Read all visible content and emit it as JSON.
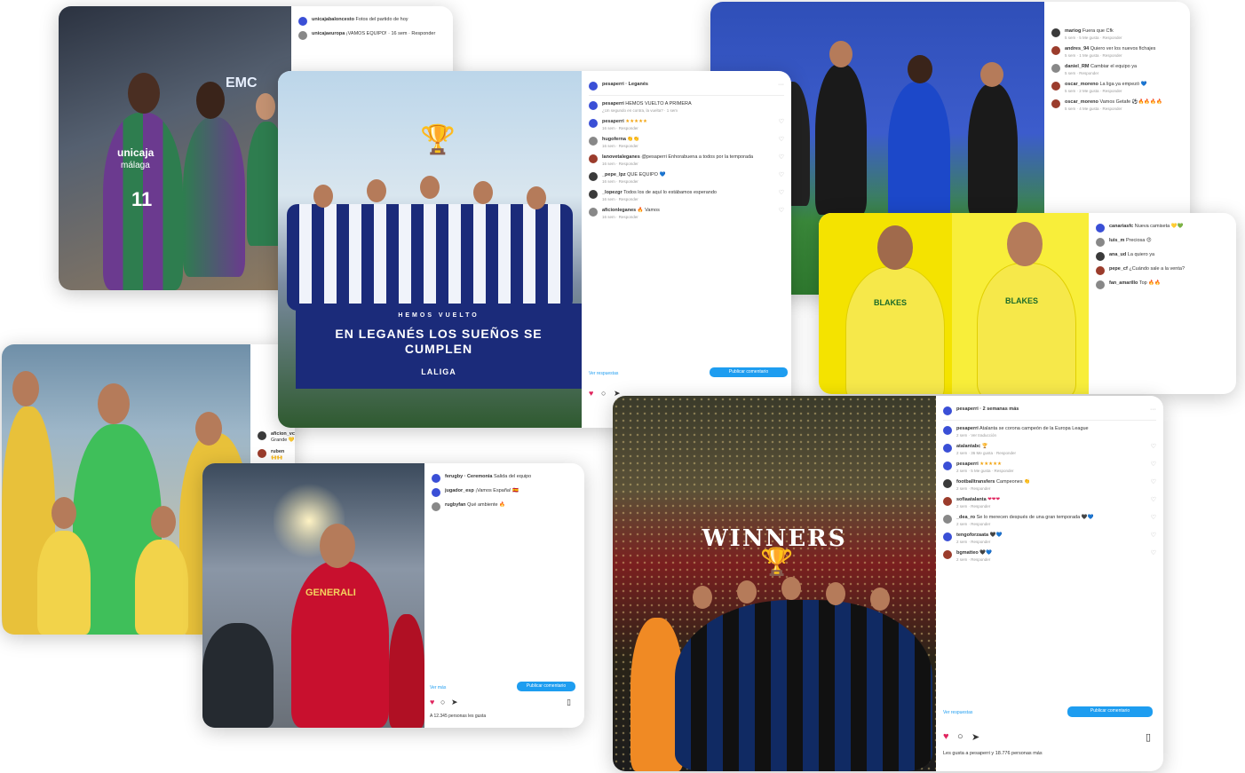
{
  "cards": {
    "basket": {
      "jersey_word": "unicaja",
      "jersey_sub": "málaga",
      "jersey_number": "11",
      "arena_sign": "EMC",
      "comments": [
        {
          "user": "unicajabaloncesto",
          "text": "Fotos del partido de hoy"
        },
        {
          "user": "unicajaeuropa",
          "text": "¡VAMOS EQUIPO! · 16 sem · Responder"
        }
      ]
    },
    "leganes": {
      "header_user": "pesaperri · Leganés",
      "banner_kicker": "HEMOS VUELTO",
      "banner_text": "EN LEGANÉS LOS SUEÑOS SE CUMPLEN",
      "banner_league": "LALIGA",
      "comments": [
        {
          "user": "pesaperri",
          "text": "HEMOS VUELTO A PRIMERA",
          "meta": "¿Un segundo en contra, la vuelta? · 1 sem"
        },
        {
          "user": "pesaperri",
          "text": "★★★★★",
          "meta": "16 sem · Responder"
        },
        {
          "user": "hugoferna",
          "text": "👏👏",
          "meta": "16 sem · Responder"
        },
        {
          "user": "lanovetaleganes",
          "text": "@pesaperri Enhorabuena a todos por la temporada",
          "meta": "16 sem · Responder"
        },
        {
          "user": "_pepe_lpz",
          "text": "QUE EQUIPO 💙",
          "meta": "16 sem · Responder"
        },
        {
          "user": "_lopezgr",
          "text": "Todos los de aquí lo estábamos esperando",
          "meta": "16 sem · Responder"
        },
        {
          "user": "aficionleganes",
          "text": "🔥 Vamos",
          "meta": "16 sem · Responder"
        }
      ],
      "view_more": "Ver respuestas",
      "button": "Publicar comentario"
    },
    "getafe": {
      "comments": [
        {
          "user": "mariog",
          "text": "Fuera que Cfk",
          "meta": "5 sem · 5 Me gusta · Responder"
        },
        {
          "user": "andres_94",
          "text": "Quiero ver los nuevos fichajes",
          "meta": "5 sem · 1 Me gusta · Responder"
        },
        {
          "user": "daniel_RM",
          "text": "Cambiar el equipo ya",
          "meta": "5 sem · Responder"
        },
        {
          "user": "oscar_moreno",
          "text": "La liga ya empezó 💙",
          "meta": "5 sem · 2 Me gusta · Responder"
        },
        {
          "user": "oscar_moreno",
          "text": "Vamos Getafe ⚽🔥🔥🔥🔥",
          "meta": "5 sem · 4 Me gusta · Responder"
        }
      ]
    },
    "yellow": {
      "shirt_sponsor": "BLAKES",
      "comments": [
        {
          "user": "canariasfc",
          "text": "Nueva camiseta 💛💚"
        },
        {
          "user": "luis_m",
          "text": "Preciosa 😍"
        },
        {
          "user": "ana_ud",
          "text": "La quiero ya"
        },
        {
          "user": "pepe_cf",
          "text": "¿Cuándo sale a la venta?"
        },
        {
          "user": "fan_amarillo",
          "text": "Top 🔥🔥"
        }
      ]
    },
    "anthem": {
      "comments": [
        {
          "user": "aficion_vcf",
          "text": "Grande 💛"
        },
        {
          "user": "ruben",
          "text": "🙌🙌"
        }
      ]
    },
    "rugby": {
      "shirt_sponsor": "GENERALI",
      "comments": [
        {
          "user": "ferugby · Ceremonia",
          "text": "Salida del equipo"
        },
        {
          "user": "jugador_esp",
          "text": "¡Vamos España! 🇪🇸"
        },
        {
          "user": "rugbyfan",
          "text": "Qué ambiente 🔥"
        }
      ],
      "view_more": "Ver más",
      "button": "Publicar comentario",
      "likes": "A 12.345 personas les gusta"
    },
    "winners": {
      "header_user": "pesaperri · 2 semanas más",
      "banner": "WINNERS",
      "comments": [
        {
          "user": "pesaperri",
          "text": "Atalanta se corona campeón de la Europa League",
          "meta": "2 sem · Ver traducción"
        },
        {
          "user": "atalantabc",
          "text": "🏆",
          "meta": "2 sem · 36 Me gusta · Responder"
        },
        {
          "user": "pesaperri",
          "text": "★★★★★",
          "meta": "2 sem · 5 Me gusta · Responder"
        },
        {
          "user": "footballtransfers",
          "text": "Campeones 👏",
          "meta": "2 sem · Responder"
        },
        {
          "user": "sofiaatalanta",
          "text": "❤❤❤",
          "meta": "2 sem · Responder"
        },
        {
          "user": "_dea_ro",
          "text": "Se lo merecen después de una gran temporada 🖤💙",
          "meta": "2 sem · Responder"
        },
        {
          "user": "tengoforzaata",
          "text": "🖤💙",
          "meta": "2 sem · Responder"
        },
        {
          "user": "bgmatteo",
          "text": "🖤💙",
          "meta": "2 sem · Responder"
        }
      ],
      "view_more": "Ver respuestas",
      "button": "Publicar comentario",
      "likes": "Les gusta a pesaperri y 18.776 personas más"
    }
  },
  "colors": {
    "instagram_blue": "#1e9df0",
    "leganes_blue": "#1b2b7a",
    "unicaja_green": "#2e7d4f",
    "unicaja_purple": "#6b3a8f",
    "getafe_blue": "#1c48c9",
    "canary_yellow": "#f4e300",
    "spain_red": "#c8102e",
    "atalanta_blue": "#102a63"
  },
  "icons": [
    "heart-icon",
    "comment-icon",
    "share-icon",
    "bookmark-icon",
    "trophy-icon"
  ]
}
